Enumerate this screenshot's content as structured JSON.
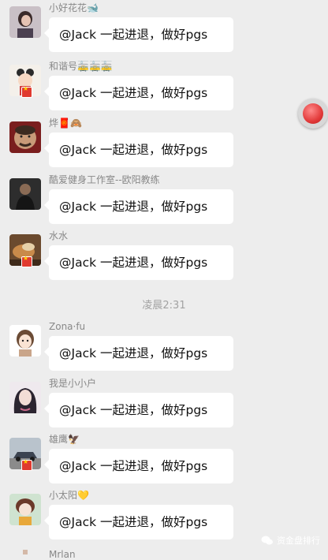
{
  "chat": {
    "timestamp": "凌晨2:31",
    "messages": [
      {
        "sender": "小好花花🐋",
        "text": "@Jack 一起进退，做好pgs",
        "avatar": "avatar-woman-dark-hair"
      },
      {
        "sender": "和谐号🚋🚋🚋",
        "text": "@Jack 一起进退，做好pgs",
        "avatar": "avatar-cartoon-girl"
      },
      {
        "sender": "烨🧧🙈",
        "text": "@Jack 一起进退，做好pgs",
        "avatar": "avatar-man-face"
      },
      {
        "sender": "酷爱健身工作室--欧阳教练",
        "text": "@Jack 一起进退，做好pgs",
        "avatar": "avatar-man-dark"
      },
      {
        "sender": "水水",
        "text": "@Jack 一起进退，做好pgs",
        "avatar": "avatar-food"
      },
      {
        "sender": "Zona·fu",
        "text": "@Jack 一起进退，做好pgs",
        "avatar": "avatar-cartoon-face"
      },
      {
        "sender": "我是小小户",
        "text": "@Jack 一起进退，做好pgs",
        "avatar": "avatar-anime-girl"
      },
      {
        "sender": "雄鹰🦅",
        "text": "@Jack 一起进退，做好pgs",
        "avatar": "avatar-car"
      },
      {
        "sender": "小太阳💛",
        "text": "@Jack 一起进退，做好pgs",
        "avatar": "avatar-girl-drawing"
      },
      {
        "sender": "Mrlan",
        "text": "",
        "avatar": "avatar-partial"
      }
    ]
  },
  "watermark": {
    "text": "资金盘排行",
    "icon": "wechat-icon"
  },
  "floating_button": {
    "icon": "record-icon"
  }
}
